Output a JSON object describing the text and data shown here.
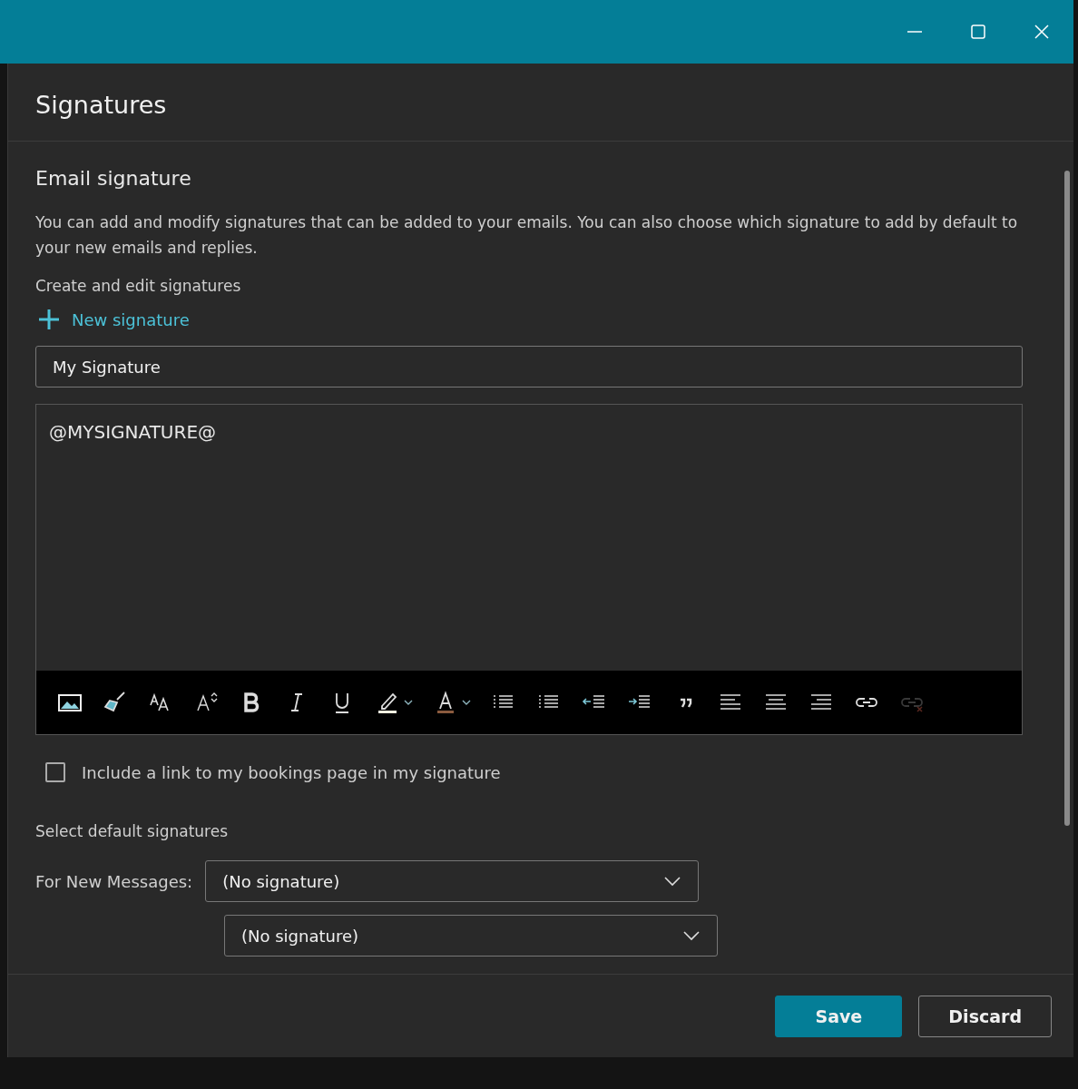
{
  "dialog": {
    "title": "Signatures"
  },
  "section": {
    "heading": "Email signature",
    "description": "You can add and modify signatures that can be added to your emails. You can also choose which signature to add by default to your new emails and replies.",
    "create_label": "Create and edit signatures",
    "new_signature_link": "New signature"
  },
  "signature_name": {
    "value": "My Signature"
  },
  "editor": {
    "content": "@MYSIGNATURE@"
  },
  "toolbar": [
    {
      "kind": "picture",
      "disabled": false
    },
    {
      "kind": "painter",
      "disabled": false
    },
    {
      "kind": "fontsize",
      "disabled": false
    },
    {
      "kind": "grow",
      "disabled": false
    },
    {
      "kind": "bold",
      "disabled": false
    },
    {
      "kind": "italic",
      "disabled": false
    },
    {
      "kind": "underline",
      "disabled": false
    },
    {
      "kind": "highlight",
      "disabled": false
    },
    {
      "kind": "fontcolor",
      "disabled": false
    },
    {
      "kind": "bullets",
      "disabled": false
    },
    {
      "kind": "numbering",
      "disabled": false
    },
    {
      "kind": "outdent",
      "disabled": false
    },
    {
      "kind": "indent",
      "disabled": false
    },
    {
      "kind": "quote",
      "disabled": false
    },
    {
      "kind": "alignleft",
      "disabled": false
    },
    {
      "kind": "aligncenter",
      "disabled": false
    },
    {
      "kind": "alignright",
      "disabled": false
    },
    {
      "kind": "link",
      "disabled": false
    },
    {
      "kind": "unlink",
      "disabled": true
    }
  ],
  "bookings_checkbox": {
    "label": "Include a link to my bookings page in my signature",
    "checked": false
  },
  "defaults": {
    "heading": "Select default signatures",
    "new_messages_label": "For New Messages:",
    "new_messages_value": "(No signature)",
    "replies_value": "(No signature)"
  },
  "footer": {
    "buttons": [
      {
        "label": "Save",
        "kind": "primary"
      },
      {
        "label": "Discard",
        "kind": "secondary"
      }
    ]
  }
}
